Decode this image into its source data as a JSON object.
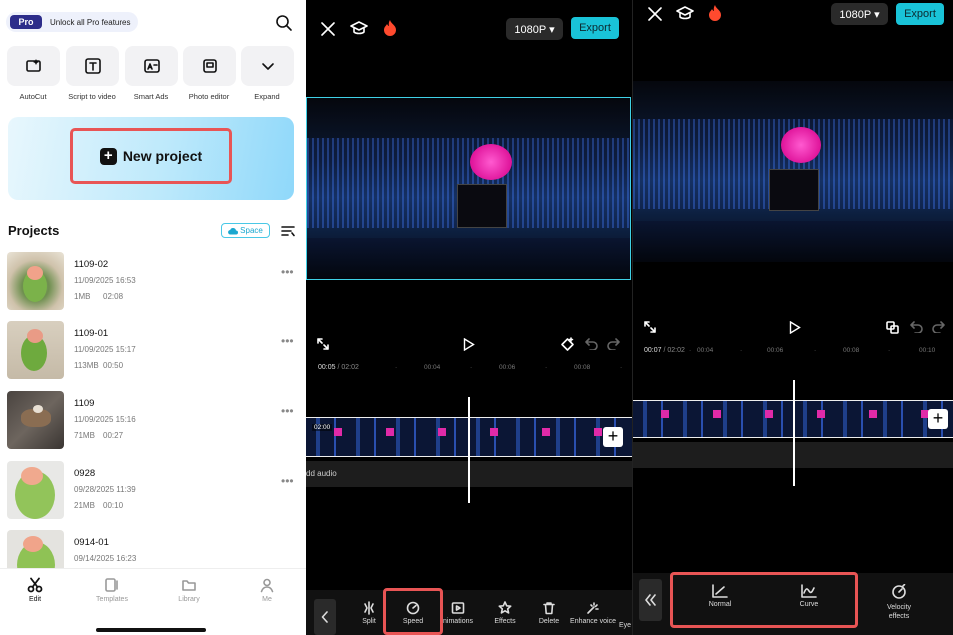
{
  "panel1": {
    "pro_badge": "Pro",
    "pro_text": "Unlock all Pro features",
    "tools": [
      "AutoCut",
      "Script to video",
      "Smart Ads",
      "Photo editor",
      "Expand"
    ],
    "new_project": "New project",
    "projects_title": "Projects",
    "space_label": "Space",
    "projects": [
      {
        "name": "1109-02",
        "date": "11/09/2025 16:53",
        "size": "1MB",
        "duration": "02:08"
      },
      {
        "name": "1109-01",
        "date": "11/09/2025 15:17",
        "size": "113MB",
        "duration": "00:50"
      },
      {
        "name": "1109",
        "date": "11/09/2025 15:16",
        "size": "71MB",
        "duration": "00:27"
      },
      {
        "name": "0928",
        "date": "09/28/2025 11:39",
        "size": "21MB",
        "duration": "00:10"
      },
      {
        "name": "0914-01",
        "date": "09/14/2025 16:23",
        "size": "",
        "duration": ""
      }
    ],
    "more": "•••",
    "nav": [
      "Edit",
      "Templates",
      "Library",
      "Me"
    ]
  },
  "panel2": {
    "resolution": "1080P ▾",
    "export": "Export",
    "current_time": "00:05",
    "total_time": "/ 02:02",
    "ticks": [
      "·",
      "00:04",
      "·",
      "00:06",
      "·",
      "00:08",
      "·"
    ],
    "clip_time": "02:00",
    "add_audio": "dd audio",
    "toolbar": [
      "Split",
      "Speed",
      "nimations",
      "Effects",
      "Delete",
      "Enhance voice",
      "Eye"
    ]
  },
  "panel3": {
    "resolution": "1080P ▾",
    "export": "Export",
    "current_time": "00:07",
    "total_time": "/ 02:02",
    "ticks": [
      "·",
      "00:04",
      "·",
      "00:06",
      "·",
      "00:08",
      "·",
      "00:10"
    ],
    "speed_options": [
      "Normal",
      "Curve",
      "Velocity effects"
    ]
  },
  "colors": {
    "accent": "#19c3d8",
    "highlight": "#e85555",
    "space": "#49c8e6"
  }
}
